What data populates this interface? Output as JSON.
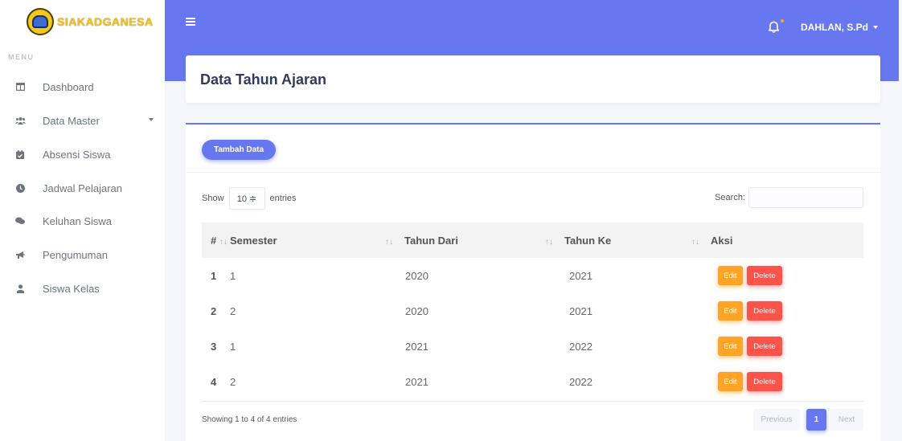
{
  "brand": {
    "name": "SIAKADGANESA"
  },
  "sidebar": {
    "menu_header": "MENU",
    "items": [
      {
        "label": "Dashboard",
        "icon": "table-columns-icon"
      },
      {
        "label": "Data Master",
        "icon": "users-icon",
        "has_submenu": true
      },
      {
        "label": "Absensi Siswa",
        "icon": "calendar-check-icon"
      },
      {
        "label": "Jadwal Pelajaran",
        "icon": "clock-icon"
      },
      {
        "label": "Keluhan Siswa",
        "icon": "comments-icon"
      },
      {
        "label": "Pengumuman",
        "icon": "bullhorn-icon"
      },
      {
        "label": "Siswa Kelas",
        "icon": "user-icon"
      }
    ]
  },
  "navbar": {
    "user_name": "DAHLAN, S.Pd",
    "menu_icon": "bars-icon",
    "notification_icon": "bell-icon"
  },
  "page": {
    "title": "Data Tahun Ajaran"
  },
  "toolbar": {
    "add_label": "Tambah Data"
  },
  "table_controls": {
    "show_label": "Show",
    "length_value": "10 ≑",
    "entries_label": "entries",
    "search_label": "Search:",
    "search_value": ""
  },
  "table": {
    "columns": [
      "#",
      "Semester",
      "Tahun Dari",
      "Tahun Ke",
      "Aksi"
    ],
    "sort_glyph": "↑↓",
    "rows": [
      {
        "no": "1",
        "semester": "1",
        "dari": "2020",
        "ke": "2021"
      },
      {
        "no": "2",
        "semester": "2",
        "dari": "2020",
        "ke": "2021"
      },
      {
        "no": "3",
        "semester": "1",
        "dari": "2021",
        "ke": "2022"
      },
      {
        "no": "4",
        "semester": "2",
        "dari": "2021",
        "ke": "2022"
      }
    ],
    "edit_label": "Edit",
    "delete_label": "Delete"
  },
  "footer": {
    "info": "Showing 1 to 4 of 4 entries",
    "prev_label": "Previous",
    "page": "1",
    "next_label": "Next"
  },
  "colors": {
    "primary": "#6777ef",
    "warning": "#ffa426",
    "danger": "#fc544b"
  }
}
